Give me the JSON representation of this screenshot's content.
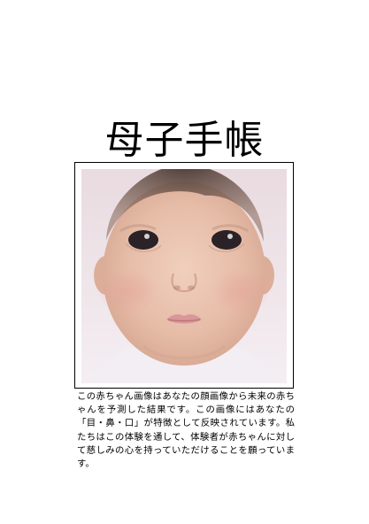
{
  "document": {
    "title": "母子手帳",
    "caption": "この赤ちゃん画像はあなたの顔画像から未来の赤ちゃんを予測した結果です。この画像にはあなたの「目・鼻・口」が特徴として反映されています。私たちはこの体験を通して、体験者が赤ちゃんに対して慈しみの心を持っていただけることを願っています。"
  },
  "photo": {
    "subject": "baby-face-portrait",
    "colors": {
      "background": "#efe6ea",
      "skin": "#e7c0ac",
      "hair": "#5e4a44",
      "eyes": "#221d22",
      "lips": "#d9979a",
      "frame": "#000000"
    }
  }
}
